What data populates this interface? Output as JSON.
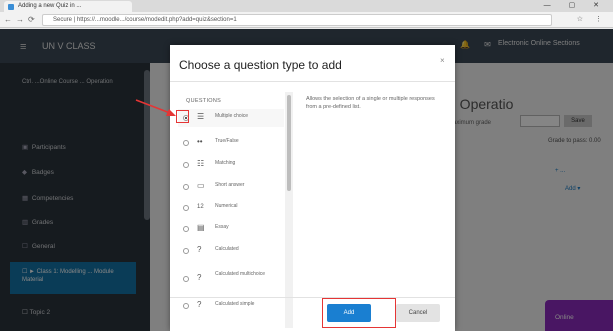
{
  "browser": {
    "tab_title": "Adding a new Quiz in ...",
    "window_controls": "— ▢ ✕",
    "url": "Secure | https://...moodle.../course/modedit.php?add=quiz&section=1",
    "nav": {
      "back": "←",
      "forward": "→",
      "reload": "⟳"
    },
    "right_icons": "☆ ⋮"
  },
  "header": {
    "menu_icon": "≡",
    "site_name": "UN V CLASS",
    "user": "Electronic Online Sections",
    "icons": "🔔 ✉"
  },
  "sidebar": {
    "course_title": "Ctrl. ...Online Course ... Operation",
    "items": [
      {
        "icon": "▣",
        "label": "Participants"
      },
      {
        "icon": "◆",
        "label": "Badges"
      },
      {
        "icon": "▦",
        "label": "Competencies"
      },
      {
        "icon": "▥",
        "label": "Grades"
      },
      {
        "icon": "☐",
        "label": "General"
      }
    ],
    "active_item": "☐ ► Class 1: Modelling ... Module Material",
    "bottom_item": "☐ Topic 2"
  },
  "main": {
    "title": "n Operatio",
    "bg_label": "Maximum grade",
    "bg_button": "Save",
    "bg_note": "Grade to pass: 0.00",
    "bg_link": "+ ...",
    "bg_link2": "Add ▾"
  },
  "modal": {
    "title": "Choose a question type to add",
    "close": "×",
    "section_label": "QUESTIONS",
    "types": [
      {
        "icon": "☰",
        "label": "Multiple choice",
        "selected": true
      },
      {
        "icon": "••",
        "label": "True/False",
        "selected": false
      },
      {
        "icon": "☷",
        "label": "Matching",
        "selected": false
      },
      {
        "icon": "▭",
        "label": "Short answer",
        "selected": false
      },
      {
        "icon": "12",
        "label": "Numerical",
        "selected": false
      },
      {
        "icon": "▤",
        "label": "Essay",
        "selected": false
      },
      {
        "icon": "?",
        "label": "Calculated",
        "selected": false
      },
      {
        "icon": "?",
        "label": "Calculated multichoice",
        "selected": false
      },
      {
        "icon": "?",
        "label": "Calculated simple",
        "selected": false
      }
    ],
    "description": "Allows the selection of a single or multiple responses from a pre-defined list.",
    "add_button": "Add",
    "cancel_button": "Cancel"
  },
  "online_badge": "Online",
  "colors": {
    "accent": "#1a7fd1",
    "annotation": "#e53535",
    "online_badge": "#8c2bbf",
    "navbar": "#3c4a57",
    "sidebar": "#2b343d"
  }
}
